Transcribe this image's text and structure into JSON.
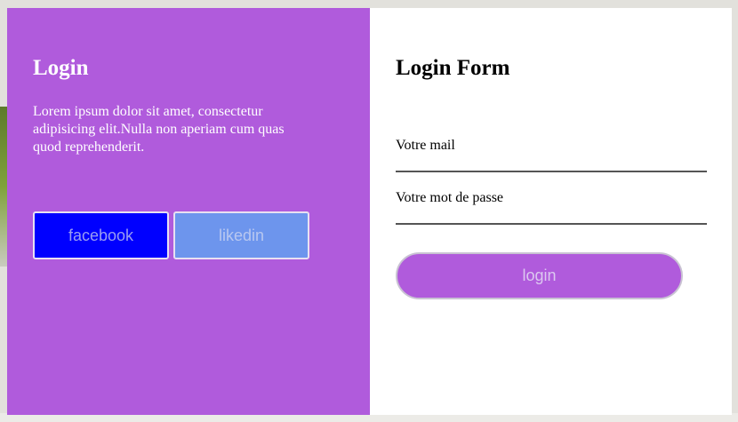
{
  "left_panel": {
    "title": "Login",
    "text": "Lorem ipsum dolor sit amet, consectetur adipisicing elit.Nulla non aperiam cum quas quod reprehenderit.",
    "facebook_label": "facebook",
    "linkedin_label": "likedin",
    "background_color": "#b05bdc"
  },
  "form": {
    "title": "Login Form",
    "email_placeholder": "Votre mail",
    "email_value": "",
    "password_placeholder": "Votre mot de passe",
    "password_value": "",
    "login_label": "login"
  },
  "colors": {
    "accent": "#b05bdc",
    "facebook": "#0000ff",
    "linkedin": "#6d95ed"
  }
}
